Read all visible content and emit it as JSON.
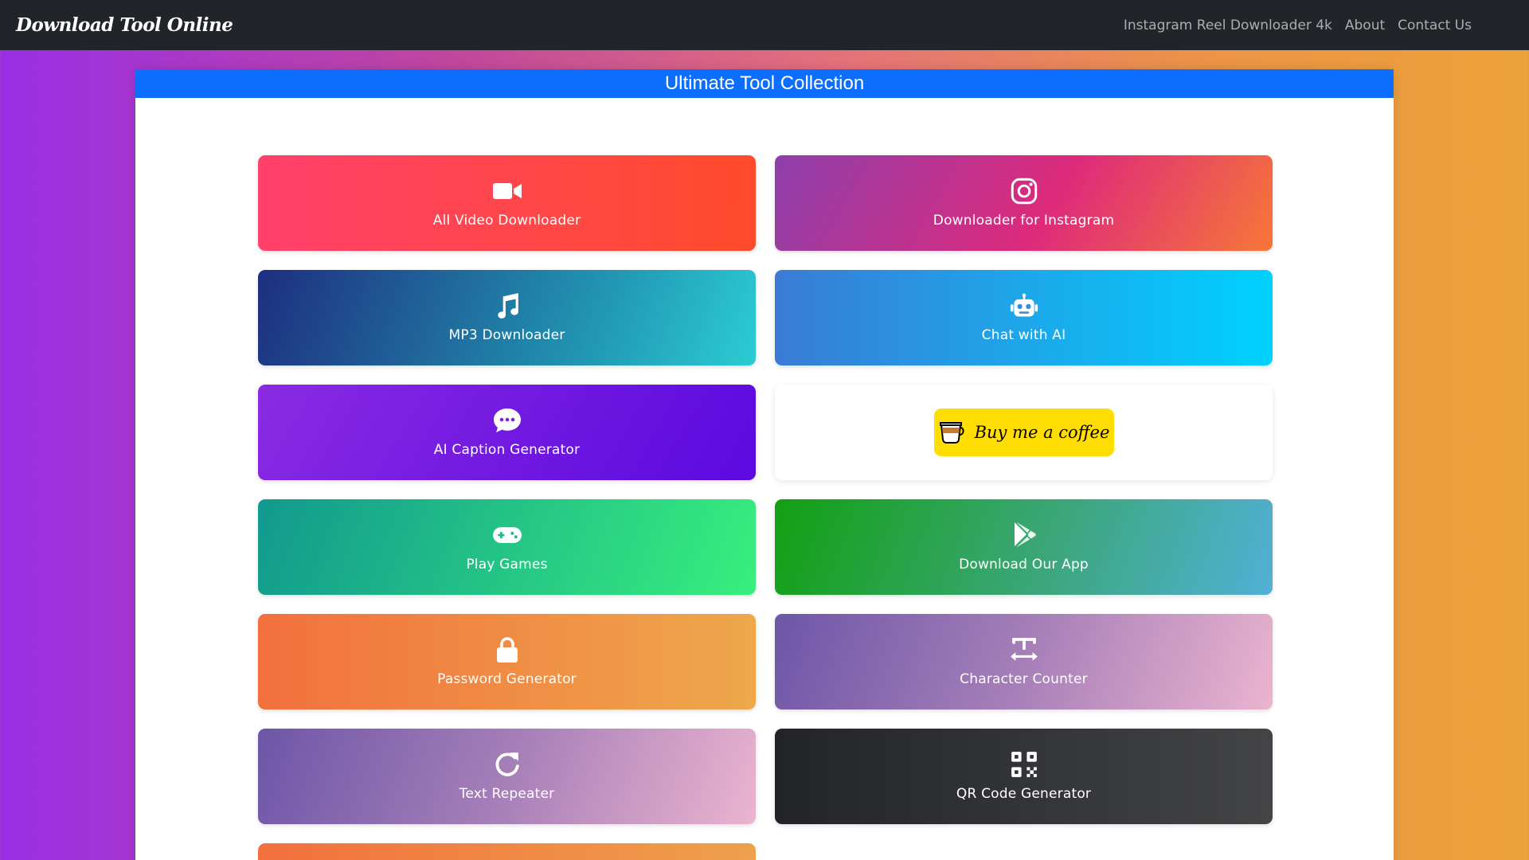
{
  "navbar": {
    "brand": "Download Tool Online",
    "links": [
      "Instagram Reel Downloader 4k",
      "About",
      "Contact Us"
    ]
  },
  "panel": {
    "title": "Ultimate Tool Collection"
  },
  "tools": [
    {
      "label": "All Video Downloader",
      "icon": "video-camera-icon"
    },
    {
      "label": "Downloader for Instagram",
      "icon": "instagram-icon"
    },
    {
      "label": "MP3 Downloader",
      "icon": "music-note-icon"
    },
    {
      "label": "Chat with AI",
      "icon": "robot-icon"
    },
    {
      "label": "AI Caption Generator",
      "icon": "chat-bubble-icon"
    },
    {
      "label": "Buy me a coffee",
      "icon": "coffee-cup-icon"
    },
    {
      "label": "Play Games",
      "icon": "gamepad-icon"
    },
    {
      "label": "Download Our App",
      "icon": "play-store-icon"
    },
    {
      "label": "Password Generator",
      "icon": "lock-icon"
    },
    {
      "label": "Character Counter",
      "icon": "text-width-icon"
    },
    {
      "label": "Text Repeater",
      "icon": "redo-icon"
    },
    {
      "label": "QR Code Generator",
      "icon": "qr-code-icon"
    }
  ],
  "colors": {
    "navbar_bg": "#212529",
    "header_blue": "#0d6efd",
    "coffee_yellow": "#ffdd00"
  }
}
